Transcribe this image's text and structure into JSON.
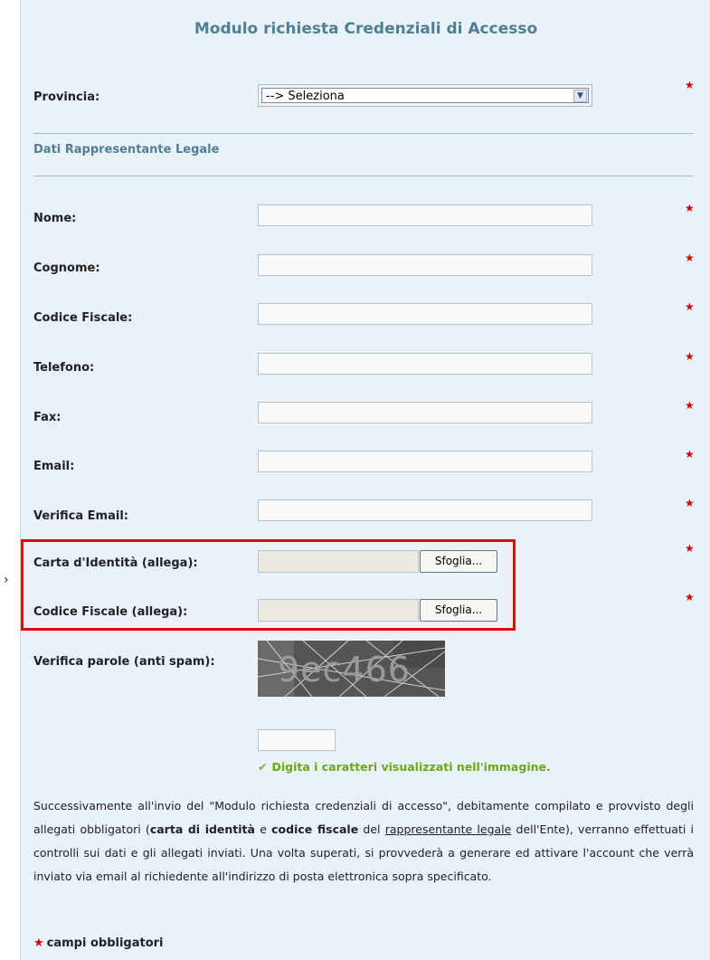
{
  "form": {
    "title": "Modulo richiesta Credenziali di Accesso",
    "provincia": {
      "label": "Provincia:",
      "selected": "--> Seleziona",
      "required": true
    },
    "section_title": "Dati Rappresentante Legale",
    "fields": {
      "nome": {
        "label": "Nome:",
        "value": ""
      },
      "cognome": {
        "label": "Cognome:",
        "value": ""
      },
      "codice_fiscale": {
        "label": "Codice Fiscale:",
        "value": ""
      },
      "telefono": {
        "label": "Telefono:",
        "value": ""
      },
      "fax": {
        "label": "Fax:",
        "value": ""
      },
      "email": {
        "label": "Email:",
        "value": ""
      },
      "verifica_email": {
        "label": "Verifica Email:",
        "value": ""
      }
    },
    "attachments": {
      "carta_identita": {
        "label": "Carta d'Identità (allega):",
        "button": "Sfoglia..."
      },
      "codice_fiscale": {
        "label": "Codice Fiscale (allega):",
        "button": "Sfoglia..."
      }
    },
    "captcha": {
      "label": "Verifica parole (anti spam):",
      "image_text": "9ec466",
      "hint": "Digita i caratteri visualizzati nell'immagine."
    },
    "info": {
      "part1": "Successivamente all'invio del \"Modulo richiesta credenziali di accesso\", debitamente compilato e provvisto degli allegati obbligatori (",
      "bold1": "carta di identità",
      "part2": " e ",
      "bold2": "codice fiscale",
      "part3": " del ",
      "underline": "rappresentante legale",
      "part4": " dell'Ente), verranno effettuati i controlli sui dati e gli allegati inviati. Una volta superati, si provvederà a generare ed attivare l'account che verrà inviato via email al richiedente all'indirizzo di posta elettronica sopra specificato."
    },
    "required_star": "★",
    "footnote": "campi obbligatori"
  },
  "colors": {
    "title": "#4f7f95",
    "required": "#d40000",
    "hint": "#6ea51a",
    "highlight_border": "#e30000",
    "background": "#e9f2f8"
  }
}
